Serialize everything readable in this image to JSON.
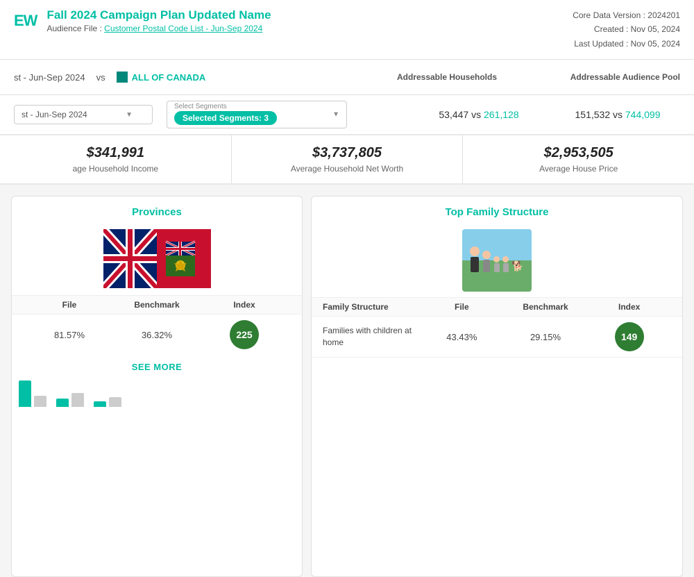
{
  "header": {
    "logo": "EW",
    "title": "Fall 2024 Campaign Plan Updated Name",
    "subtitle_prefix": "Audience File : ",
    "subtitle_link": "Customer Postal Code List - Jun-Sep 2024",
    "meta": {
      "core_data_version": "Core Data Version : 2024201",
      "created": "Created : Nov 05, 2024",
      "last_updated": "Last Updated : Nov 05, 2024"
    }
  },
  "toolbar": {
    "vs_label": "vs",
    "canada_label": "ALL OF CANADA"
  },
  "filter_row": {
    "audience_file_label": "st - Jun-Sep 2024",
    "select_segments_label": "Select Segments",
    "segments_pill": "Selected Segments: 3",
    "addressable_households_label": "Addressable Households",
    "addressable_audience_pool_label": "Addressable Audience Pool",
    "hh_file_value": "53,447",
    "hh_vs": "vs",
    "hh_benchmark": "261,128",
    "pool_file_value": "151,532",
    "pool_vs": "vs",
    "pool_benchmark": "744,099"
  },
  "metrics": [
    {
      "value": "$341,991",
      "label": "age Household Income"
    },
    {
      "value": "$3,737,805",
      "label": "Average Household Net Worth"
    },
    {
      "value": "$2,953,505",
      "label": "Average House Price"
    }
  ],
  "provinces": {
    "title": "Provinces",
    "table_headers": [
      "File",
      "Benchmark",
      "Index"
    ],
    "rows": [
      {
        "file": "81.57%",
        "benchmark": "36.32%",
        "index": "225"
      }
    ],
    "see_more": "SEE MORE"
  },
  "family_structure": {
    "title": "Top Family Structure",
    "col_headers": [
      "Family Structure",
      "File",
      "Benchmark",
      "Index"
    ],
    "rows": [
      {
        "structure": "Families with children at home",
        "file": "43.43%",
        "benchmark": "29.15%",
        "index": "149"
      }
    ]
  }
}
